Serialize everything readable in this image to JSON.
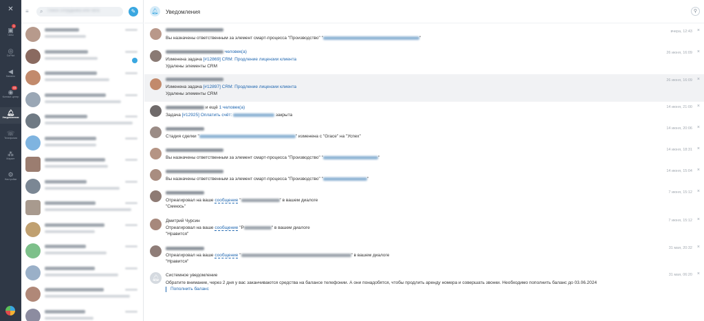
{
  "sidebar": {
    "items": [
      {
        "icon": "chat-icon",
        "label": "Чаты",
        "badge": "1"
      },
      {
        "icon": "coffee-icon",
        "label": "CoPilot"
      },
      {
        "icon": "channel-icon",
        "label": "Каналы"
      },
      {
        "icon": "contact-center-icon",
        "label": "Контакт-центр",
        "badge": "44"
      },
      {
        "icon": "bell-icon",
        "label": "Уведомления",
        "active": true
      },
      {
        "icon": "phone-icon",
        "label": "Телефония"
      },
      {
        "icon": "market-icon",
        "label": "Маркет"
      },
      {
        "icon": "gear-icon",
        "label": "Настройки"
      }
    ]
  },
  "chatlist": {
    "search_placeholder": "Поиск сотрудника или чата"
  },
  "main": {
    "title": "Уведомления"
  },
  "notifications": [
    {
      "type": "person",
      "line1_prefix": "Вы назначены ответственным за элемент смарт-процесса \"Производство\" \"",
      "line1_suffix": "\"",
      "time": "вчера, 12:43"
    },
    {
      "type": "person",
      "title_suffix": "человек(а)",
      "line1_prefix": "Изменена задача ",
      "task_id": "[#12869]",
      "task_name": "CRM: Продление лицензии клиента",
      "line2": "Удалены элементы CRM",
      "time": "26 июня, 16:09"
    },
    {
      "type": "person",
      "highlighted": true,
      "line1_prefix": "Изменена задача ",
      "task_id": "[#12897]",
      "task_name": "CRM: Продление лицензии клиента",
      "line2": "Удалены элементы CRM",
      "time": "26 июня, 16:09"
    },
    {
      "type": "person",
      "title_mid": "и ещё",
      "title_suffix": "1 человек(а)",
      "line1_prefix": "Задача ",
      "task_id": "[#12925]",
      "task_name": "Оплатить счёт:",
      "line1_suffix": "закрыта",
      "time": "14 июня, 21:00"
    },
    {
      "type": "person",
      "line1_prefix": "Стадия сделки \"",
      "deal_from": "изменена с \"Grace\" на \"Успех\"",
      "time": "14 июня, 20:06"
    },
    {
      "type": "person",
      "line1_prefix": "Вы назначены ответственным за элемент смарт-процесса \"Производство\" \"",
      "line1_suffix": "\"",
      "time": "14 июня, 18:31"
    },
    {
      "type": "person",
      "line1_prefix": "Вы назначены ответственным за элемент смарт-процесса \"Производство\" \"",
      "line1_suffix": "\"",
      "time": "14 июня, 15:04"
    },
    {
      "type": "person",
      "line1_prefix": "Отреагировал на ваше ",
      "msg_link": "сообщение",
      "line1_mid": "\"",
      "line1_suffix": "\" в вашем диалоге",
      "line2": "\"Смеюсь\"",
      "time": "7 июня, 15:12"
    },
    {
      "type": "person",
      "title": "Дмитрий Чурсин",
      "line1_prefix": "Отреагировал на ваше ",
      "msg_link": "сообщение",
      "line1_mid": "\"Р",
      "line1_suffix": "\" в вашем диалоге",
      "line2": "\"Нравится\"",
      "time": "7 июня, 15:12"
    },
    {
      "type": "person",
      "line1_prefix": "Отреагировал на ваше ",
      "msg_link": "сообщение",
      "line1_mid": "\"",
      "line1_suffix": "\" в вашем диалоге",
      "line2": "\"Нравится\"",
      "time": "31 мая, 20:32"
    },
    {
      "type": "system",
      "title": "Системное уведомление",
      "line1": "Обратите внимание, через 2 дня у вас заканчиваются средства на балансе телефонии. А они понадобятся, чтобы продлить аренду номера и совершать звонки. Необходимо пополнить баланс до 03.06.2024",
      "link": "Пополнить баланс",
      "time": "31 мая, 06:20"
    }
  ],
  "colors": {
    "rail": "#2f3846",
    "accent": "#3aa7e0",
    "link": "#2067b0"
  }
}
